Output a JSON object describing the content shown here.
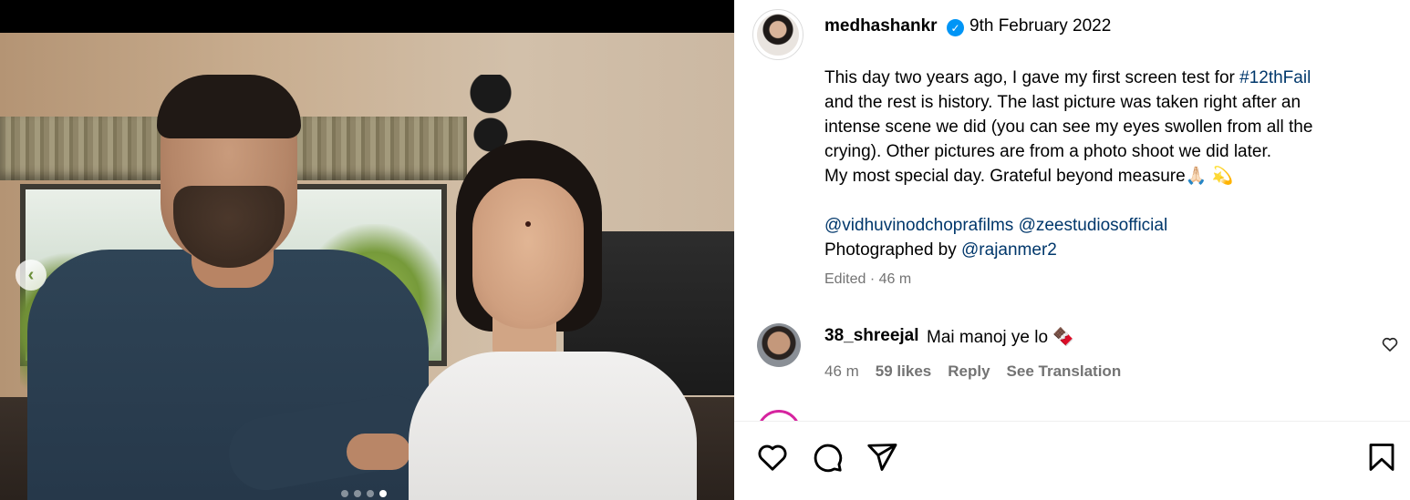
{
  "post": {
    "username": "medhashankr",
    "verified_icon": "verified-badge-icon",
    "date": "9th February 2022"
  },
  "caption": {
    "line1_prefix": "This day two years ago, I gave my first screen test for ",
    "line1_hashtag": "#12thFail",
    "line2": "and the rest is history. The last picture was taken right after an",
    "line3": "intense scene we did (you can see my eyes swollen from all the",
    "line4": "crying). Other pictures are from a photo shoot we did later.",
    "line5": "My most special day. Grateful beyond measure🙏🏻 💫",
    "mention1": "@vidhuvinodchoprafilms",
    "mention2": "@zeestudiosofficial",
    "photographed_prefix": "Photographed by ",
    "photographer": "@rajanmer2"
  },
  "edited": "Edited · 46 m",
  "comment": {
    "username": "38_shreejal",
    "text": "Mai manoj ye lo 🍫",
    "time": "46 m",
    "likes": "59 likes",
    "reply": "Reply",
    "translate": "See Translation"
  },
  "carousel": {
    "prev_icon": "chevron-left-icon",
    "dot_count": 4,
    "active_dot": 4
  },
  "actions": {
    "like_icon": "heart-icon",
    "comment_icon": "comment-icon",
    "share_icon": "send-icon",
    "save_icon": "bookmark-icon"
  },
  "colors": {
    "link": "#00376b",
    "muted": "#737373",
    "verified": "#0095f6"
  }
}
